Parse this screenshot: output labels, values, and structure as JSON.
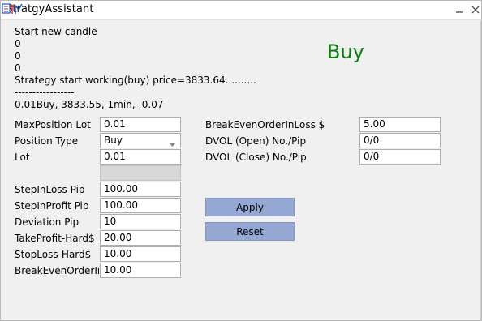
{
  "window": {
    "title": "StratgyAssistant"
  },
  "status": {
    "lines": [
      "Start new candle",
      "0",
      "0",
      "0",
      "Strategy start working(buy) price=3833.64.........."
    ],
    "divider": "-----------------",
    "summary": "0.01Buy,  3833.55,  1min,  -0.07",
    "signal": "Buy",
    "signal_color": "#0a7d0a"
  },
  "left_form": {
    "max_position_lot": {
      "label": "MaxPosition Lot",
      "value": "0.01"
    },
    "position_type": {
      "label": "Position Type",
      "value": "Buy"
    },
    "lot": {
      "label": "Lot",
      "value": "0.01"
    },
    "step_in_loss": {
      "label": "StepInLoss Pip",
      "value": "100.00"
    },
    "step_in_profit": {
      "label": "StepInProfit Pip",
      "value": "100.00"
    },
    "deviation": {
      "label": "Deviation Pip",
      "value": "10"
    },
    "take_profit": {
      "label": "TakeProfit-Hard$",
      "value": "20.00"
    },
    "stop_loss": {
      "label": "StopLoss-Hard$",
      "value": "10.00"
    },
    "break_even_order_in": {
      "label": "BreakEvenOrderIn",
      "value": "10.00"
    }
  },
  "right_form": {
    "break_even_order_in_loss": {
      "label": "BreakEvenOrderInLoss $",
      "value": "5.00"
    },
    "dvol_open": {
      "label": "DVOL (Open) No./Pip",
      "value": "0/0"
    },
    "dvol_close": {
      "label": "DVOL (Close) No./Pip",
      "value": "0/0"
    }
  },
  "buttons": {
    "apply": "Apply",
    "reset": "Reset",
    "color": "#95a8d3"
  },
  "icons": {
    "app": "app-logo-icon",
    "minimize": "minimize-icon",
    "close": "close-icon"
  }
}
